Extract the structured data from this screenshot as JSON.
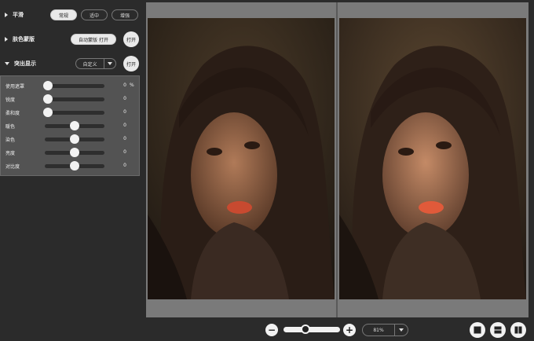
{
  "sections": {
    "smooth": {
      "title": "平滑",
      "options": [
        "常规",
        "适中",
        "增强"
      ],
      "selected": "常规"
    },
    "skin_mask": {
      "title": "肤色蒙版",
      "auto_button": "自动蒙版 打开",
      "toggle": "打开"
    },
    "highlight": {
      "title": "突出显示",
      "preset": "自定义",
      "toggle": "打开"
    }
  },
  "sliders": [
    {
      "label": "使用遮罩",
      "value": "0",
      "unit": "%",
      "level": 0
    },
    {
      "label": "锐度",
      "value": "0",
      "unit": "",
      "level": 0
    },
    {
      "label": "柔和度",
      "value": "0",
      "unit": "",
      "level": 0
    },
    {
      "label": "暖色",
      "value": "0",
      "unit": "",
      "level": 0.5
    },
    {
      "label": "染色",
      "value": "0",
      "unit": "",
      "level": 0.5
    },
    {
      "label": "亮度",
      "value": "0",
      "unit": "",
      "level": 0.5
    },
    {
      "label": "对比度",
      "value": "0",
      "unit": "",
      "level": 0.5
    }
  ],
  "zoom": {
    "minus": "−",
    "plus": "+",
    "value": "81%"
  },
  "colors": {
    "panel": "#2b2b2b",
    "slider_box": "#535353",
    "preview_bg": "#7a7a7a"
  }
}
